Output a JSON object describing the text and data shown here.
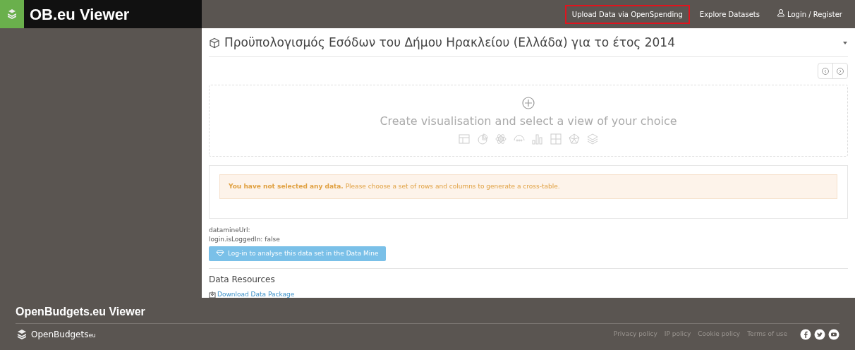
{
  "brand": {
    "title": "OB.eu Viewer"
  },
  "nav": [
    {
      "label": "Upload Data via OpenSpending",
      "highlighted": true,
      "kind": "link"
    },
    {
      "label": "Explore Datasets",
      "highlighted": false,
      "kind": "link"
    },
    {
      "label": "Login / Register",
      "highlighted": false,
      "kind": "user"
    }
  ],
  "dataset": {
    "title": "Προϋπολογισμός Εσόδων του Δήμου Ηρακλείου (Ελλάδα) για το έτος 2014"
  },
  "visualisation": {
    "prompt": "Create visualisation and select a view of your choice"
  },
  "alert": {
    "text": "**You have not selected any data.** Please choose a set of rows and columns to generate a cross-table."
  },
  "debug": [
    "datamineUrl:",
    "login.isLoggedIn: false"
  ],
  "datamine_button": "Log-in to analyse this data set in the Data Mine",
  "resources": {
    "heading": "Data Resources",
    "link": "Download Data Package"
  },
  "footer": {
    "title": "OpenBudgets.eu Viewer",
    "logo": "OpenBudgets",
    "logo_suffix": "eu",
    "links": [
      "Privacy policy",
      "IP policy",
      "Cookie policy",
      "Terms of use"
    ]
  }
}
